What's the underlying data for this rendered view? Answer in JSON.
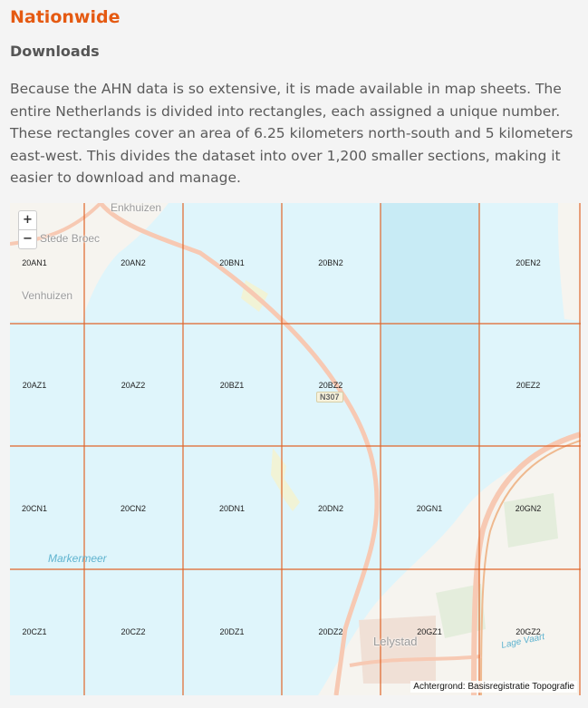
{
  "section": {
    "title": "Nationwide",
    "subtitle": "Downloads",
    "description": "Because the AHN data is so extensive, it is made available in map sheets. The entire Netherlands is divided into rectangles, each assigned a unique number. These rectangles cover an area of 6.25 kilometers north-south and 5 kilometers east-west. This divides the dataset into over 1,200 smaller sections, making it easier to download and manage."
  },
  "map": {
    "zoom_in": "+",
    "zoom_out": "−",
    "attribution": "Achtergrond: Basisregistratie Topografie",
    "places": {
      "enkhuizen": "Enkhuizen",
      "stede_broec": "Stede Broec",
      "venhuizen": "Venhuizen",
      "lelystad": "Lelystad",
      "markermeer": "Markermeer",
      "lage_vaart": "Lage Vaart"
    },
    "road": "N307",
    "colors": {
      "grid": "#e0662a",
      "water": "#dff5fb",
      "selected_water": "#c8ebf5",
      "land": "#f6f4ef",
      "road": "#f7c9b3"
    },
    "sheets": [
      [
        "20AN1",
        "20AN2",
        "20BN1",
        "20BN2",
        "",
        "20EN2"
      ],
      [
        "20AZ1",
        "20AZ2",
        "20BZ1",
        "20BZ2",
        "",
        "20EZ2"
      ],
      [
        "20CN1",
        "20CN2",
        "20DN1",
        "20DN2",
        "20GN1",
        "20GN2"
      ],
      [
        "20CZ1",
        "20CZ2",
        "20DZ1",
        "20DZ2",
        "20GZ1",
        "20GZ2"
      ]
    ]
  }
}
